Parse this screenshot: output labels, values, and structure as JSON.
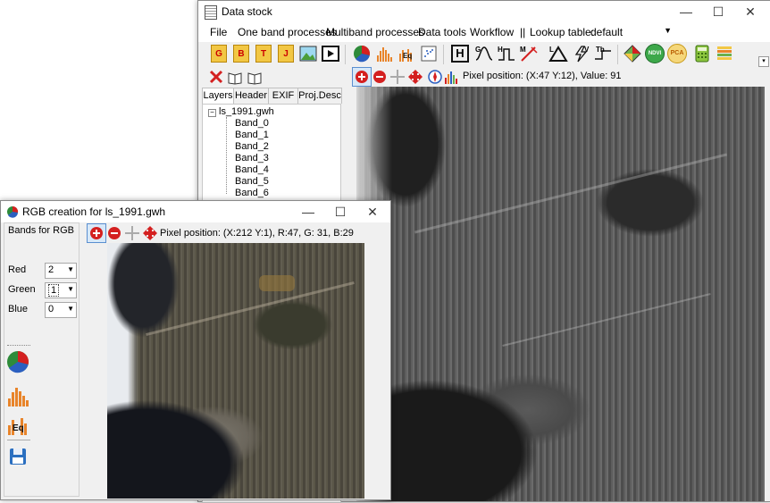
{
  "main_window": {
    "title": "Data stock",
    "caption": {
      "minimize": "—",
      "maximize": "☐",
      "close": "✕"
    },
    "menu": [
      {
        "label": "File"
      },
      {
        "label": "One band processes"
      },
      {
        "label": "Multiband processes"
      },
      {
        "label": "Data tools"
      },
      {
        "label": "Workflow"
      },
      {
        "label": "||"
      },
      {
        "label": "Lookup table:"
      }
    ],
    "lookup_table_value": "default",
    "toolbar_letters": [
      "G",
      "B",
      "T",
      "J"
    ],
    "toolbar_text": {
      "h_box": "H",
      "ndvi": "NDVI",
      "pca": "PCA",
      "eq": "Eq"
    },
    "pixel_info": "Pixel position: (X:47 Y:12), Value: 91",
    "tabs": [
      "Layers",
      "Header",
      "EXIF",
      "Proj.Desc"
    ],
    "tree": {
      "root": "ls_1991.gwh",
      "bands": [
        "Band_0",
        "Band_1",
        "Band_2",
        "Band_3",
        "Band_4",
        "Band_5",
        "Band_6"
      ]
    }
  },
  "rgb_window": {
    "title": "RGB creation for ls_1991.gwh",
    "caption": {
      "minimize": "—",
      "maximize": "☐",
      "close": "✕"
    },
    "group_label": "Bands for RGB",
    "bands": [
      {
        "label": "Red",
        "value": "2"
      },
      {
        "label": "Green",
        "value": "1"
      },
      {
        "label": "Blue",
        "value": "0"
      }
    ],
    "eq_label": "Eq",
    "pixel_info": "Pixel position: (X:212 Y:1), R:47, G: 31, B:29"
  },
  "colors": {
    "titlebar": "#ffffff",
    "window_bg": "#f0f0f0",
    "accent_red": "#d42020",
    "histogram_orange": "#e8842a"
  }
}
